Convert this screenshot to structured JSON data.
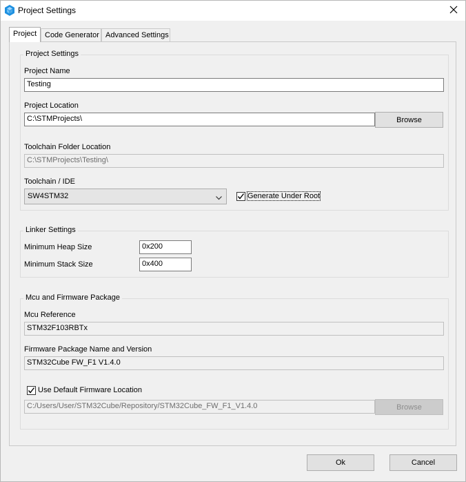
{
  "window": {
    "title": "Project Settings",
    "icon": "cube-icon"
  },
  "tabs": [
    {
      "label": "Project",
      "active": true
    },
    {
      "label": "Code Generator",
      "active": false
    },
    {
      "label": "Advanced Settings",
      "active": false
    }
  ],
  "project_settings": {
    "title": "Project Settings",
    "project_name_label": "Project Name",
    "project_name_value": "Testing",
    "project_location_label": "Project Location",
    "project_location_value": "C:\\STMProjects\\",
    "browse_label": "Browse",
    "toolchain_folder_label": "Toolchain Folder Location",
    "toolchain_folder_value": "C:\\STMProjects\\Testing\\",
    "toolchain_ide_label": "Toolchain / IDE",
    "toolchain_ide_value": "SW4STM32",
    "generate_under_root_label": "Generate Under Root",
    "generate_under_root_checked": true
  },
  "linker_settings": {
    "title": "Linker Settings",
    "min_heap_label": "Minimum Heap Size",
    "min_heap_value": "0x200",
    "min_stack_label": "Minimum Stack Size",
    "min_stack_value": "0x400"
  },
  "mcu_firmware": {
    "title": "Mcu and Firmware Package",
    "mcu_reference_label": "Mcu Reference",
    "mcu_reference_value": "STM32F103RBTx",
    "firmware_package_label": "Firmware Package Name and Version",
    "firmware_package_value": "STM32Cube FW_F1 V1.4.0",
    "use_default_label": "Use Default Firmware Location",
    "use_default_checked": true,
    "firmware_location_value": "C:/Users/User/STM32Cube/Repository/STM32Cube_FW_F1_V1.4.0",
    "browse_label": "Browse"
  },
  "footer": {
    "ok_label": "Ok",
    "cancel_label": "Cancel"
  },
  "colors": {
    "accent": "#1e90e0",
    "window_bg": "#f0f0f0"
  }
}
